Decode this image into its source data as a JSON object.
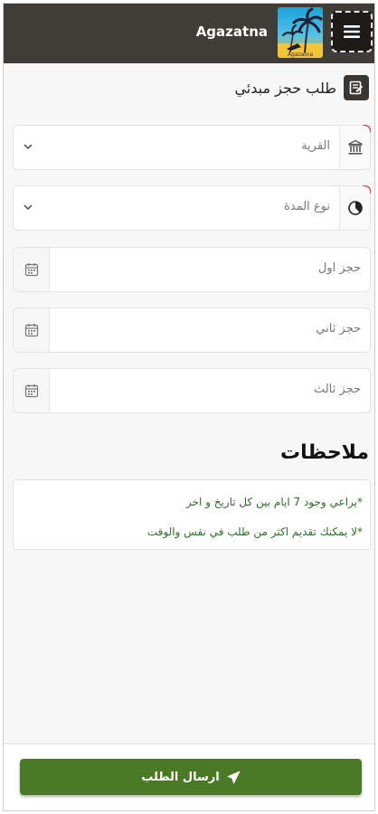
{
  "header": {
    "brand": "Agazatna",
    "logo_caption": "Agazatna",
    "menu_icon": "hamburger-icon",
    "background": "#403c38"
  },
  "page": {
    "title": "طلب حجز مبدئي",
    "title_icon": "edit-form-icon"
  },
  "form": {
    "village": {
      "value": "القرية",
      "icon": "institution-icon",
      "required": true
    },
    "duration": {
      "value": "نوع المدة",
      "icon": "adjust-icon",
      "required": true
    },
    "booking_1": {
      "placeholder": "حجز اول",
      "icon": "calendar-icon"
    },
    "booking_2": {
      "placeholder": "حجز ثاني",
      "icon": "calendar-icon"
    },
    "booking_3": {
      "placeholder": "حجز ثالث",
      "icon": "calendar-icon"
    }
  },
  "notes": {
    "title": "ملاحظات",
    "lines": [
      "*يراعي وجود 7 ايام بين كل تاريخ و اخر",
      "*لا يمكنك تقديم اكثر من طلب في نفس والوقت"
    ],
    "color": "#2f6b2a"
  },
  "footer": {
    "submit_label": "ارسال الطلب",
    "submit_icon": "paper-plane-icon",
    "accent": "#4a7a25"
  }
}
